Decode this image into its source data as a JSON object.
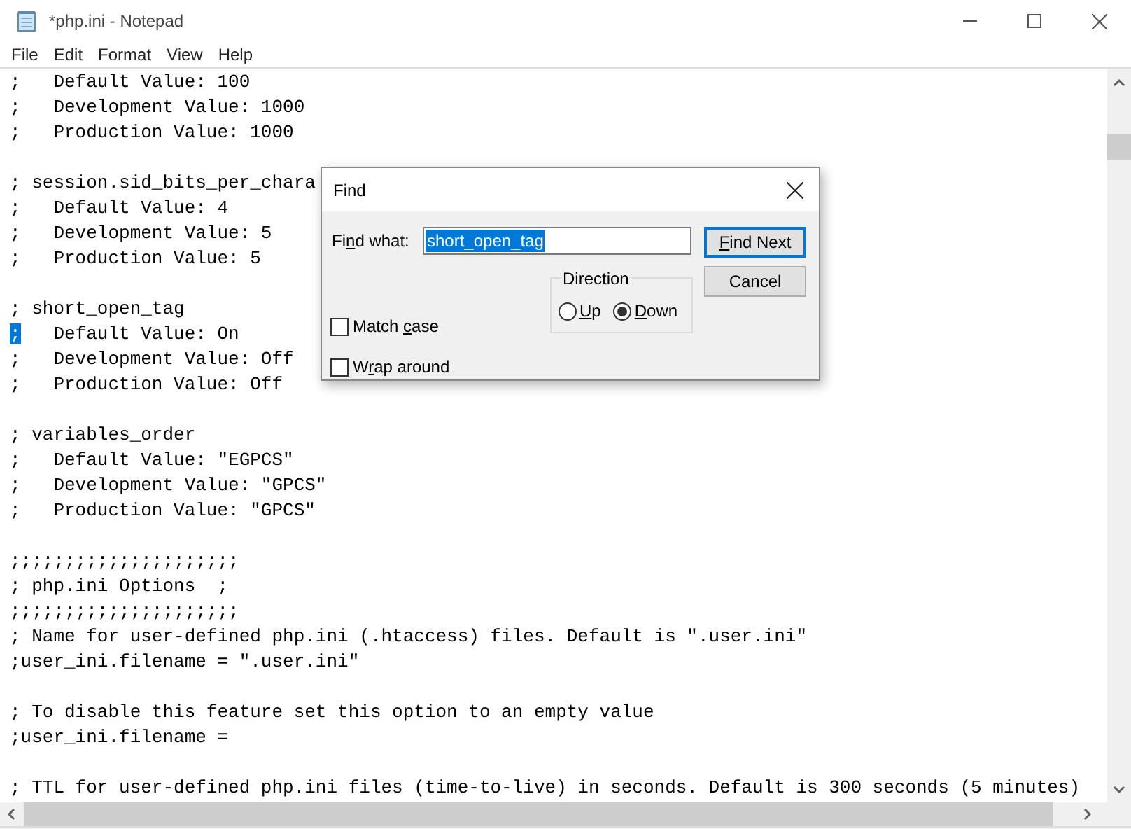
{
  "window": {
    "title": "*php.ini - Notepad"
  },
  "menu": [
    {
      "label": "File"
    },
    {
      "label": "Edit"
    },
    {
      "label": "Format"
    },
    {
      "label": "View"
    },
    {
      "label": "Help"
    }
  ],
  "lines": [
    {
      "kind": "text",
      "text": ";   Default Value: 100"
    },
    {
      "kind": "text",
      "text": ";   Development Value: 1000"
    },
    {
      "kind": "text",
      "text": ";   Production Value: 1000"
    },
    {
      "kind": "blank"
    },
    {
      "kind": "text",
      "text": "; session.sid_bits_per_chara"
    },
    {
      "kind": "text",
      "text": ";   Default Value: 4"
    },
    {
      "kind": "text",
      "text": ";   Development Value: 5"
    },
    {
      "kind": "text",
      "text": ";   Production Value: 5"
    },
    {
      "kind": "blank"
    },
    {
      "kind": "text",
      "text": "; short_open_tag"
    },
    {
      "kind": "text",
      "selected_text": ";",
      "text": "   Default Value: On"
    },
    {
      "kind": "text",
      "text": ";   Development Value: Off"
    },
    {
      "kind": "text",
      "text": ";   Production Value: Off"
    },
    {
      "kind": "blank"
    },
    {
      "kind": "text",
      "text": "; variables_order"
    },
    {
      "kind": "text",
      "text": ";   Default Value: \"EGPCS\""
    },
    {
      "kind": "text",
      "text": ";   Development Value: \"GPCS\""
    },
    {
      "kind": "text",
      "text": ";   Production Value: \"GPCS\""
    },
    {
      "kind": "blank"
    },
    {
      "kind": "text",
      "text": ";;;;;;;;;;;;;;;;;;;;;"
    },
    {
      "kind": "text",
      "text": "; php.ini Options  ;"
    },
    {
      "kind": "text",
      "text": ";;;;;;;;;;;;;;;;;;;;;"
    },
    {
      "kind": "text",
      "text": "; Name for user-defined php.ini (.htaccess) files. Default is \".user.ini\""
    },
    {
      "kind": "text",
      "text": ";user_ini.filename = \".user.ini\""
    },
    {
      "kind": "blank"
    },
    {
      "kind": "text",
      "text": "; To disable this feature set this option to an empty value"
    },
    {
      "kind": "text",
      "text": ";user_ini.filename ="
    },
    {
      "kind": "blank"
    },
    {
      "kind": "text",
      "text": "; TTL for user-defined php.ini files (time-to-live) in seconds. Default is 300 seconds (5 minutes)"
    }
  ],
  "find_dialog": {
    "title": "Find",
    "find_what": {
      "label": {
        "pre": "Fi",
        "key": "n",
        "post": "d what:"
      },
      "value": "short_open_tag"
    },
    "buttons": [
      {
        "label": {
          "key": "F",
          "post": "ind Next"
        },
        "default": true
      },
      {
        "label": {
          "pre": "Cancel"
        },
        "default": false
      }
    ],
    "options": [
      {
        "label": {
          "pre": "Match ",
          "key": "c",
          "post": "ase"
        },
        "checked": false
      },
      {
        "label": {
          "pre": "W",
          "key": "r",
          "post": "ap around"
        },
        "checked": false
      }
    ],
    "direction": {
      "title": "Direction",
      "choices": [
        {
          "label": {
            "key": "U",
            "post": "p"
          },
          "selected": false
        },
        {
          "label": {
            "key": "D",
            "post": "own"
          },
          "selected": true
        }
      ]
    }
  }
}
